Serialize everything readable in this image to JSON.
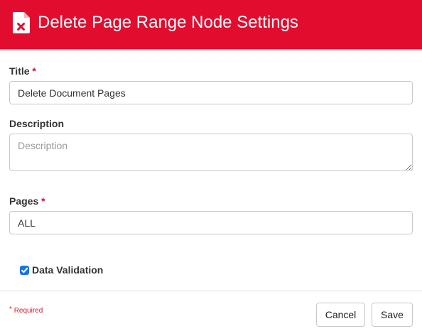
{
  "header": {
    "title": "Delete Page Range Node Settings",
    "icon": "document-delete-icon",
    "background_color": "#e20c2e"
  },
  "form": {
    "title": {
      "label": "Title",
      "required_mark": "*",
      "value": "Delete Document Pages"
    },
    "description": {
      "label": "Description",
      "placeholder": "Description",
      "value": ""
    },
    "pages": {
      "label": "Pages",
      "required_mark": "*",
      "value": "ALL"
    },
    "data_validation": {
      "label": "Data Validation",
      "checked": true
    }
  },
  "footer": {
    "required_mark": "*",
    "required_text": "Required",
    "cancel_label": "Cancel",
    "save_label": "Save"
  }
}
